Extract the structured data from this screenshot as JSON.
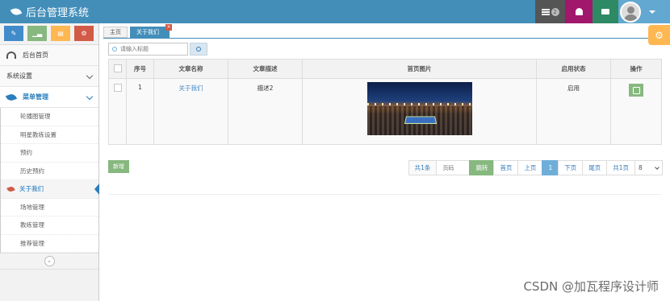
{
  "app": {
    "title": "后台管理系统"
  },
  "header": {
    "tasks_badge": "2",
    "icons": [
      "tasks-icon",
      "bell-icon",
      "mail-icon",
      "user-avatar",
      "caret-down-icon"
    ],
    "colors": {
      "navbar": "#438eb9",
      "tasks": "#555555",
      "bell": "#a0176c",
      "mail": "#2e8965",
      "user": "#62a8d1"
    }
  },
  "sidebar": {
    "shortcuts": [
      "pencil-icon",
      "signal-icon",
      "book-icon",
      "cogs-icon"
    ],
    "home": "后台首页",
    "system_settings": "系统设置",
    "menu_group": "菜单管理",
    "items": [
      "轮播图管理",
      "明星教练设置",
      "预约",
      "历史预约",
      "关于我们",
      "场地管理",
      "教练管理",
      "推荐管理"
    ],
    "active_item": "关于我们"
  },
  "main": {
    "tabs": [
      "主页",
      "关于我们"
    ],
    "tab_close": "×",
    "search_placeholder": "请输入标题",
    "columns": [
      "序号",
      "文章名称",
      "文章描述",
      "首页图片",
      "启用状态",
      "操作"
    ],
    "rows": [
      {
        "index": "1",
        "name": "关于我们",
        "description": "描述2",
        "status": "启用"
      }
    ],
    "add_button": "新增",
    "pagination": {
      "total": "共1条",
      "page_input_placeholder": "页码",
      "jump": "跳转",
      "first": "首页",
      "prev": "上页",
      "current": "1",
      "next": "下页",
      "last": "尾页",
      "total_pages": "共1页",
      "page_size": "8"
    }
  },
  "watermark": "CSDN @加瓦程序设计师"
}
